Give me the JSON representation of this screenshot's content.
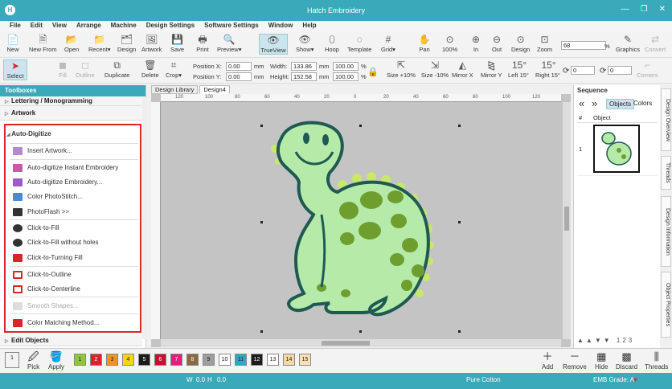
{
  "app": {
    "title": "Hatch Embroidery"
  },
  "menu": [
    "File",
    "Edit",
    "View",
    "Arrange",
    "Machine",
    "Design Settings",
    "Software Settings",
    "Window",
    "Help"
  ],
  "toolbar1": {
    "new": "New",
    "new_from": "New From",
    "open": "Open",
    "recent": "Recent",
    "design": "Design",
    "artwork": "Artwork",
    "save": "Save",
    "print": "Print",
    "preview": "Preview",
    "trueview": "TrueView",
    "show": "Show",
    "hoop": "Hoop",
    "template": "Template",
    "grid": "Grid",
    "pan": "Pan",
    "zoom100": "100%",
    "in": "In",
    "out": "Out",
    "zoom_design": "Design",
    "zoom": "Zoom",
    "zoom_value": "68",
    "zoom_unit": "%",
    "graphics": "Graphics",
    "convert": "Convert"
  },
  "toolbar2": {
    "select": "Select",
    "fill": "Fill",
    "outline": "Outline",
    "duplicate": "Duplicate",
    "delete": "Delete",
    "crop": "Crop",
    "pos_x_label": "Position X:",
    "pos_x": "0.00",
    "pos_y_label": "Position Y:",
    "pos_y": "0.00",
    "unit": "mm",
    "width_label": "Width:",
    "width": "133.86",
    "width_pct": "100.00",
    "height_label": "Height:",
    "height": "152.58",
    "height_pct": "100.00",
    "pct": "%",
    "size_plus": "Size +10%",
    "size_minus": "Size -10%",
    "mirror_x": "Mirror X",
    "mirror_y": "Mirror Y",
    "left15": "Left 15°",
    "right15": "Right 15°",
    "rot_value": "0",
    "corner_value": "0",
    "corners": "Corners",
    "left15_num": "15°",
    "right15_num": "15°"
  },
  "toolboxes": {
    "title": "Toolboxes",
    "sections": {
      "lettering": "Lettering / Monogramming",
      "artwork": "Artwork",
      "autodigitize": "Auto-Digitize",
      "edit": "Edit Objects"
    },
    "items": [
      "Insert Artwork...",
      "Auto-digitize Instant Embroidery",
      "Auto-digitize Embroidery...",
      "Color PhotoStitch...",
      "PhotoFlash >>",
      "Click-to-Fill",
      "Click-to-Fill without holes",
      "Click-to-Turning Fill",
      "Click-to-Outline",
      "Click-to-Centerline",
      "Smooth Shapes...",
      "Color Matching Method..."
    ]
  },
  "tabs": [
    "Design Library",
    "Design4"
  ],
  "ruler": [
    "120",
    "100",
    "80",
    "60",
    "40",
    "20",
    "0",
    "20",
    "40",
    "60",
    "80",
    "100",
    "120"
  ],
  "sequence": {
    "title": "Sequence",
    "objects": "Objects",
    "colors": "Colors",
    "col_num": "#",
    "col_obj": "Object",
    "row1": "1",
    "nav": "123"
  },
  "side_tabs": [
    "Design Overview",
    "Threads",
    "Design Information",
    "Object Properties"
  ],
  "palette": [
    "1",
    "2",
    "3",
    "4",
    "5",
    "6",
    "7",
    "8",
    "9",
    "10",
    "11",
    "12",
    "13",
    "14",
    "15"
  ],
  "palette_colors": [
    "#8dc63f",
    "#d7262b",
    "#f29320",
    "#f2d70f",
    "#1b1b1b",
    "#c8102e",
    "#e0207a",
    "#8a6a3e",
    "#9e9e9e",
    "#ffffff",
    "#2aa8c8",
    "#1b1b1b",
    "#ffffff",
    "#f6d7a6",
    "#f8e1b8"
  ],
  "bottom": {
    "current": "1",
    "pick": "Pick",
    "apply": "Apply",
    "add": "Add",
    "remove": "Remove",
    "hide": "Hide",
    "discard": "Discard",
    "threads": "Threads"
  },
  "status": {
    "w": "W",
    "w_val": "0.0",
    "h": "H",
    "h_val": "0.0",
    "fabric": "Pure Cotton",
    "grade": "EMB Grade: A"
  }
}
